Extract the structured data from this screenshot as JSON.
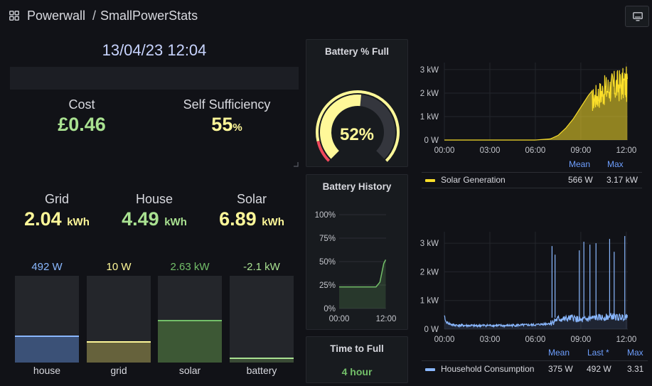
{
  "breadcrumb": {
    "folder": "Powerwall",
    "separator": "/",
    "dashboard": "SmallPowerStats"
  },
  "icons": {
    "apps": "grid-icon",
    "tv_mode": "monitor-icon"
  },
  "colors": {
    "accent_blue": "#6e9fff",
    "green": "#73bf69",
    "yellow": "#fade2a",
    "light_yellow": "#fff899",
    "light_green": "#a9e191",
    "house_blue": "#8ab8ff",
    "red": "#f2495c"
  },
  "datetime": "13/04/23 12:04",
  "cost": {
    "label": "Cost",
    "value": "£0.46"
  },
  "self_sufficiency": {
    "label": "Self Sufficiency",
    "value": "55",
    "unit": "%"
  },
  "energy": [
    {
      "label": "Grid",
      "value": "2.04",
      "unit": "kWh"
    },
    {
      "label": "House",
      "value": "4.49",
      "unit": "kWh"
    },
    {
      "label": "Solar",
      "value": "6.89",
      "unit": "kWh"
    }
  ],
  "bars": [
    {
      "label": "house",
      "value_text": "492 W",
      "level": 0.31,
      "color": "#8ab8ff",
      "fill": "#3b5177"
    },
    {
      "label": "grid",
      "value_text": "10 W",
      "level": 0.25,
      "color": "#fff899",
      "fill": "#66623c"
    },
    {
      "label": "solar",
      "value_text": "2.63 kW",
      "level": 0.49,
      "color": "#73bf69",
      "fill": "#3d5835"
    },
    {
      "label": "battery",
      "value_text": "-2.1 kW",
      "level": 0.06,
      "color": "#a9e191",
      "fill": "#3a4a35"
    }
  ],
  "battery_full": {
    "title": "Battery % Full",
    "value": "52",
    "unit": "%",
    "level": 0.52
  },
  "battery_history": {
    "title": "Battery History",
    "y_ticks": [
      "100%",
      "75%",
      "50%",
      "25%",
      "0%"
    ],
    "x_ticks": [
      "00:00",
      "12:00"
    ]
  },
  "time_to_full": {
    "title": "Time to Full",
    "value": "4 hour"
  },
  "solar_chart": {
    "y_ticks": [
      "3 kW",
      "2 kW",
      "1 kW",
      "0 W"
    ],
    "x_ticks": [
      "00:00",
      "03:00",
      "06:00",
      "09:00",
      "12:00"
    ],
    "legend_headers": [
      "Mean",
      "Max"
    ],
    "series_name": "Solar Generation",
    "legend_values": [
      "566 W",
      "3.17 kW"
    ]
  },
  "house_chart": {
    "y_ticks": [
      "3 kW",
      "2 kW",
      "1 kW",
      "0 W"
    ],
    "x_ticks": [
      "00:00",
      "03:00",
      "06:00",
      "09:00",
      "12:00"
    ],
    "legend_headers": [
      "Mean",
      "Last *",
      "Max"
    ],
    "series_name": "Household Consumption",
    "legend_values": [
      "375 W",
      "492 W",
      "3.31"
    ]
  },
  "chart_data": [
    {
      "type": "area",
      "x_unit": "hours",
      "x": [
        0,
        6,
        7,
        7.5,
        8,
        8.5,
        9,
        9.5,
        10,
        10.5,
        11,
        11.5,
        12,
        12.07
      ],
      "values": [
        0,
        0,
        0.05,
        0.2,
        0.5,
        0.9,
        1.4,
        1.9,
        2.3,
        2.6,
        2.8,
        2.9,
        3.0,
        2.6
      ],
      "y_unit": "kW",
      "ylim": [
        0,
        3.3
      ],
      "xlim": [
        0,
        12.1
      ],
      "series": [
        {
          "name": "Solar Generation",
          "mean": "566 W",
          "max": "3.17 kW"
        }
      ]
    },
    {
      "type": "line",
      "x_unit": "hours",
      "x": [
        0,
        0.1,
        0.5,
        1,
        2,
        3,
        4,
        5,
        6,
        7,
        7.3,
        7.5,
        8,
        8.5,
        9,
        9.5,
        10,
        10.5,
        11,
        11.5,
        12,
        12.07
      ],
      "values": [
        0.45,
        0.25,
        0.15,
        0.13,
        0.12,
        0.13,
        0.12,
        0.14,
        0.15,
        0.2,
        0.3,
        0.35,
        0.35,
        0.4,
        0.3,
        0.35,
        0.4,
        0.4,
        0.45,
        0.4,
        0.45,
        0.49
      ],
      "y_unit": "kW",
      "ylim": [
        0,
        3.4
      ],
      "xlim": [
        0,
        12.1
      ],
      "series": [
        {
          "name": "Household Consumption",
          "mean": "375 W",
          "last": "492 W",
          "max": "3.31"
        }
      ]
    },
    {
      "type": "line",
      "x_unit": "hours",
      "x": [
        0,
        8.5,
        9.5,
        10.5,
        11,
        11.5,
        12
      ],
      "values": [
        23,
        23,
        23,
        28,
        38,
        48,
        52
      ],
      "y_unit": "%",
      "ylim": [
        0,
        100
      ],
      "xlim": [
        0,
        12.1
      ],
      "series": [
        {
          "name": "Battery History"
        }
      ]
    }
  ]
}
